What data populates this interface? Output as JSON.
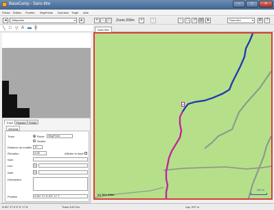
{
  "window": {
    "title": "BaseCamp - Sans titre",
    "buttons": {
      "minimize": "–",
      "maximize": "□",
      "close": "×"
    }
  },
  "menu": [
    "Fichier",
    "Édition",
    "Fenêtre",
    "WayPoints",
    "Données",
    "Trajet",
    "Aide"
  ],
  "toolbar_left": {
    "combo_value": "Wikipoints",
    "icons": [
      "arrow-left-icon",
      "arrow-right-icon"
    ]
  },
  "toolbar_right": {
    "zoom_label": "Zoom 200m",
    "map_combo": "Sans titre"
  },
  "left_tools": [
    "line-icon",
    "rectangle-icon",
    "triangle-icon",
    "text-icon",
    "fill-icon",
    "grid-icon"
  ],
  "panel": {
    "tabs": [
      "Tracé",
      "Figures",
      "Points"
    ],
    "active_tab": 0,
    "subtab": "Général",
    "fields": {
      "type_label": "Tracé",
      "type_option_1": "Route",
      "type_option_2": "Sentier",
      "type_select": "WayPoint",
      "distance_label": "Distance du modèle",
      "distance_value": "10",
      "elevation_label": "Élévation",
      "elevation_value": "0,00",
      "checkbox_label": "Afficher le tracé",
      "name_label": "Nom",
      "color_label": "Lien",
      "note_label": "Note",
      "description_label": "Description",
      "position_label": "Position",
      "position_value": "N 50° 27.5' E5° 17.7'"
    }
  },
  "map": {
    "tab_label": "Sans titre",
    "attribution": "(c) Tele Atlas",
    "scale_label": "200 m",
    "marker_label": "a",
    "colors": {
      "background": "#b6df8a",
      "track_blue": "#1e3cae",
      "track_pink": "#c0259c",
      "roads": "#8c9a8c",
      "frame": "#d93a3a"
    }
  },
  "status": {
    "coords": "N 50° 27.5' E 5° 17.6'",
    "track": "Track 4,52 Km",
    "section": "Lap, 237 m"
  }
}
